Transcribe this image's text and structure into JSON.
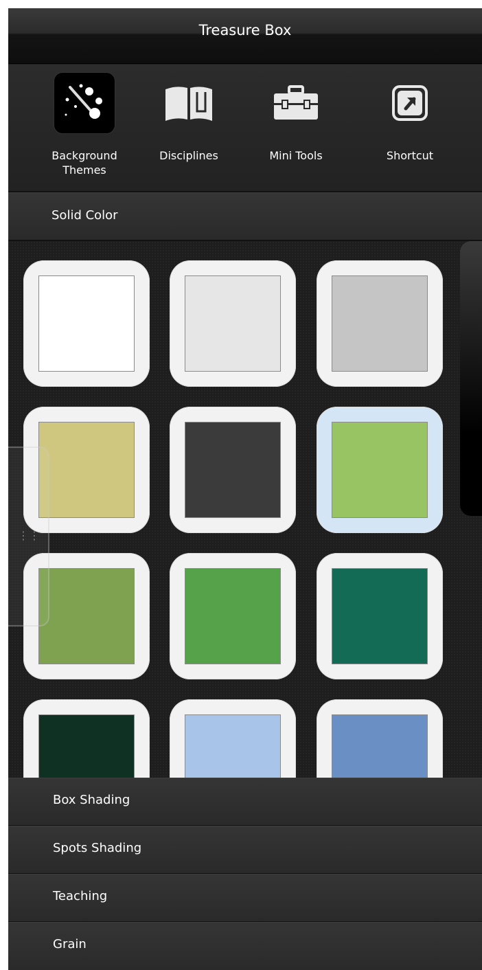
{
  "window": {
    "title": "Treasure Box"
  },
  "toolbar": {
    "items": [
      {
        "label": "Background\nThemes",
        "icon": "magic-wand-icon",
        "active": true
      },
      {
        "label": "Disciplines",
        "icon": "book-icon",
        "active": false
      },
      {
        "label": "Mini Tools",
        "icon": "toolbox-icon",
        "active": false
      },
      {
        "label": "Shortcut",
        "icon": "shortcut-icon",
        "active": false
      }
    ]
  },
  "sections": {
    "solid_color": "Solid Color",
    "box_shading": "Box Shading",
    "spots_shading": "Spots Shading",
    "teaching": "Teaching",
    "grain": "Grain"
  },
  "swatches": [
    {
      "color": "#ffffff",
      "selected": false
    },
    {
      "color": "#e6e6e6",
      "selected": false
    },
    {
      "color": "#c5c5c5",
      "selected": false
    },
    {
      "color": "#cfc77f",
      "selected": false
    },
    {
      "color": "#3b3b3b",
      "selected": false
    },
    {
      "color": "#99c463",
      "selected": true
    },
    {
      "color": "#7ea250",
      "selected": false
    },
    {
      "color": "#56a24a",
      "selected": false
    },
    {
      "color": "#146b55",
      "selected": false
    },
    {
      "color": "#0f3124",
      "selected": false
    },
    {
      "color": "#a8c4e8",
      "selected": false
    },
    {
      "color": "#6a8fc4",
      "selected": false
    }
  ],
  "side_handle": {
    "icon": "drag-handle-icon"
  }
}
